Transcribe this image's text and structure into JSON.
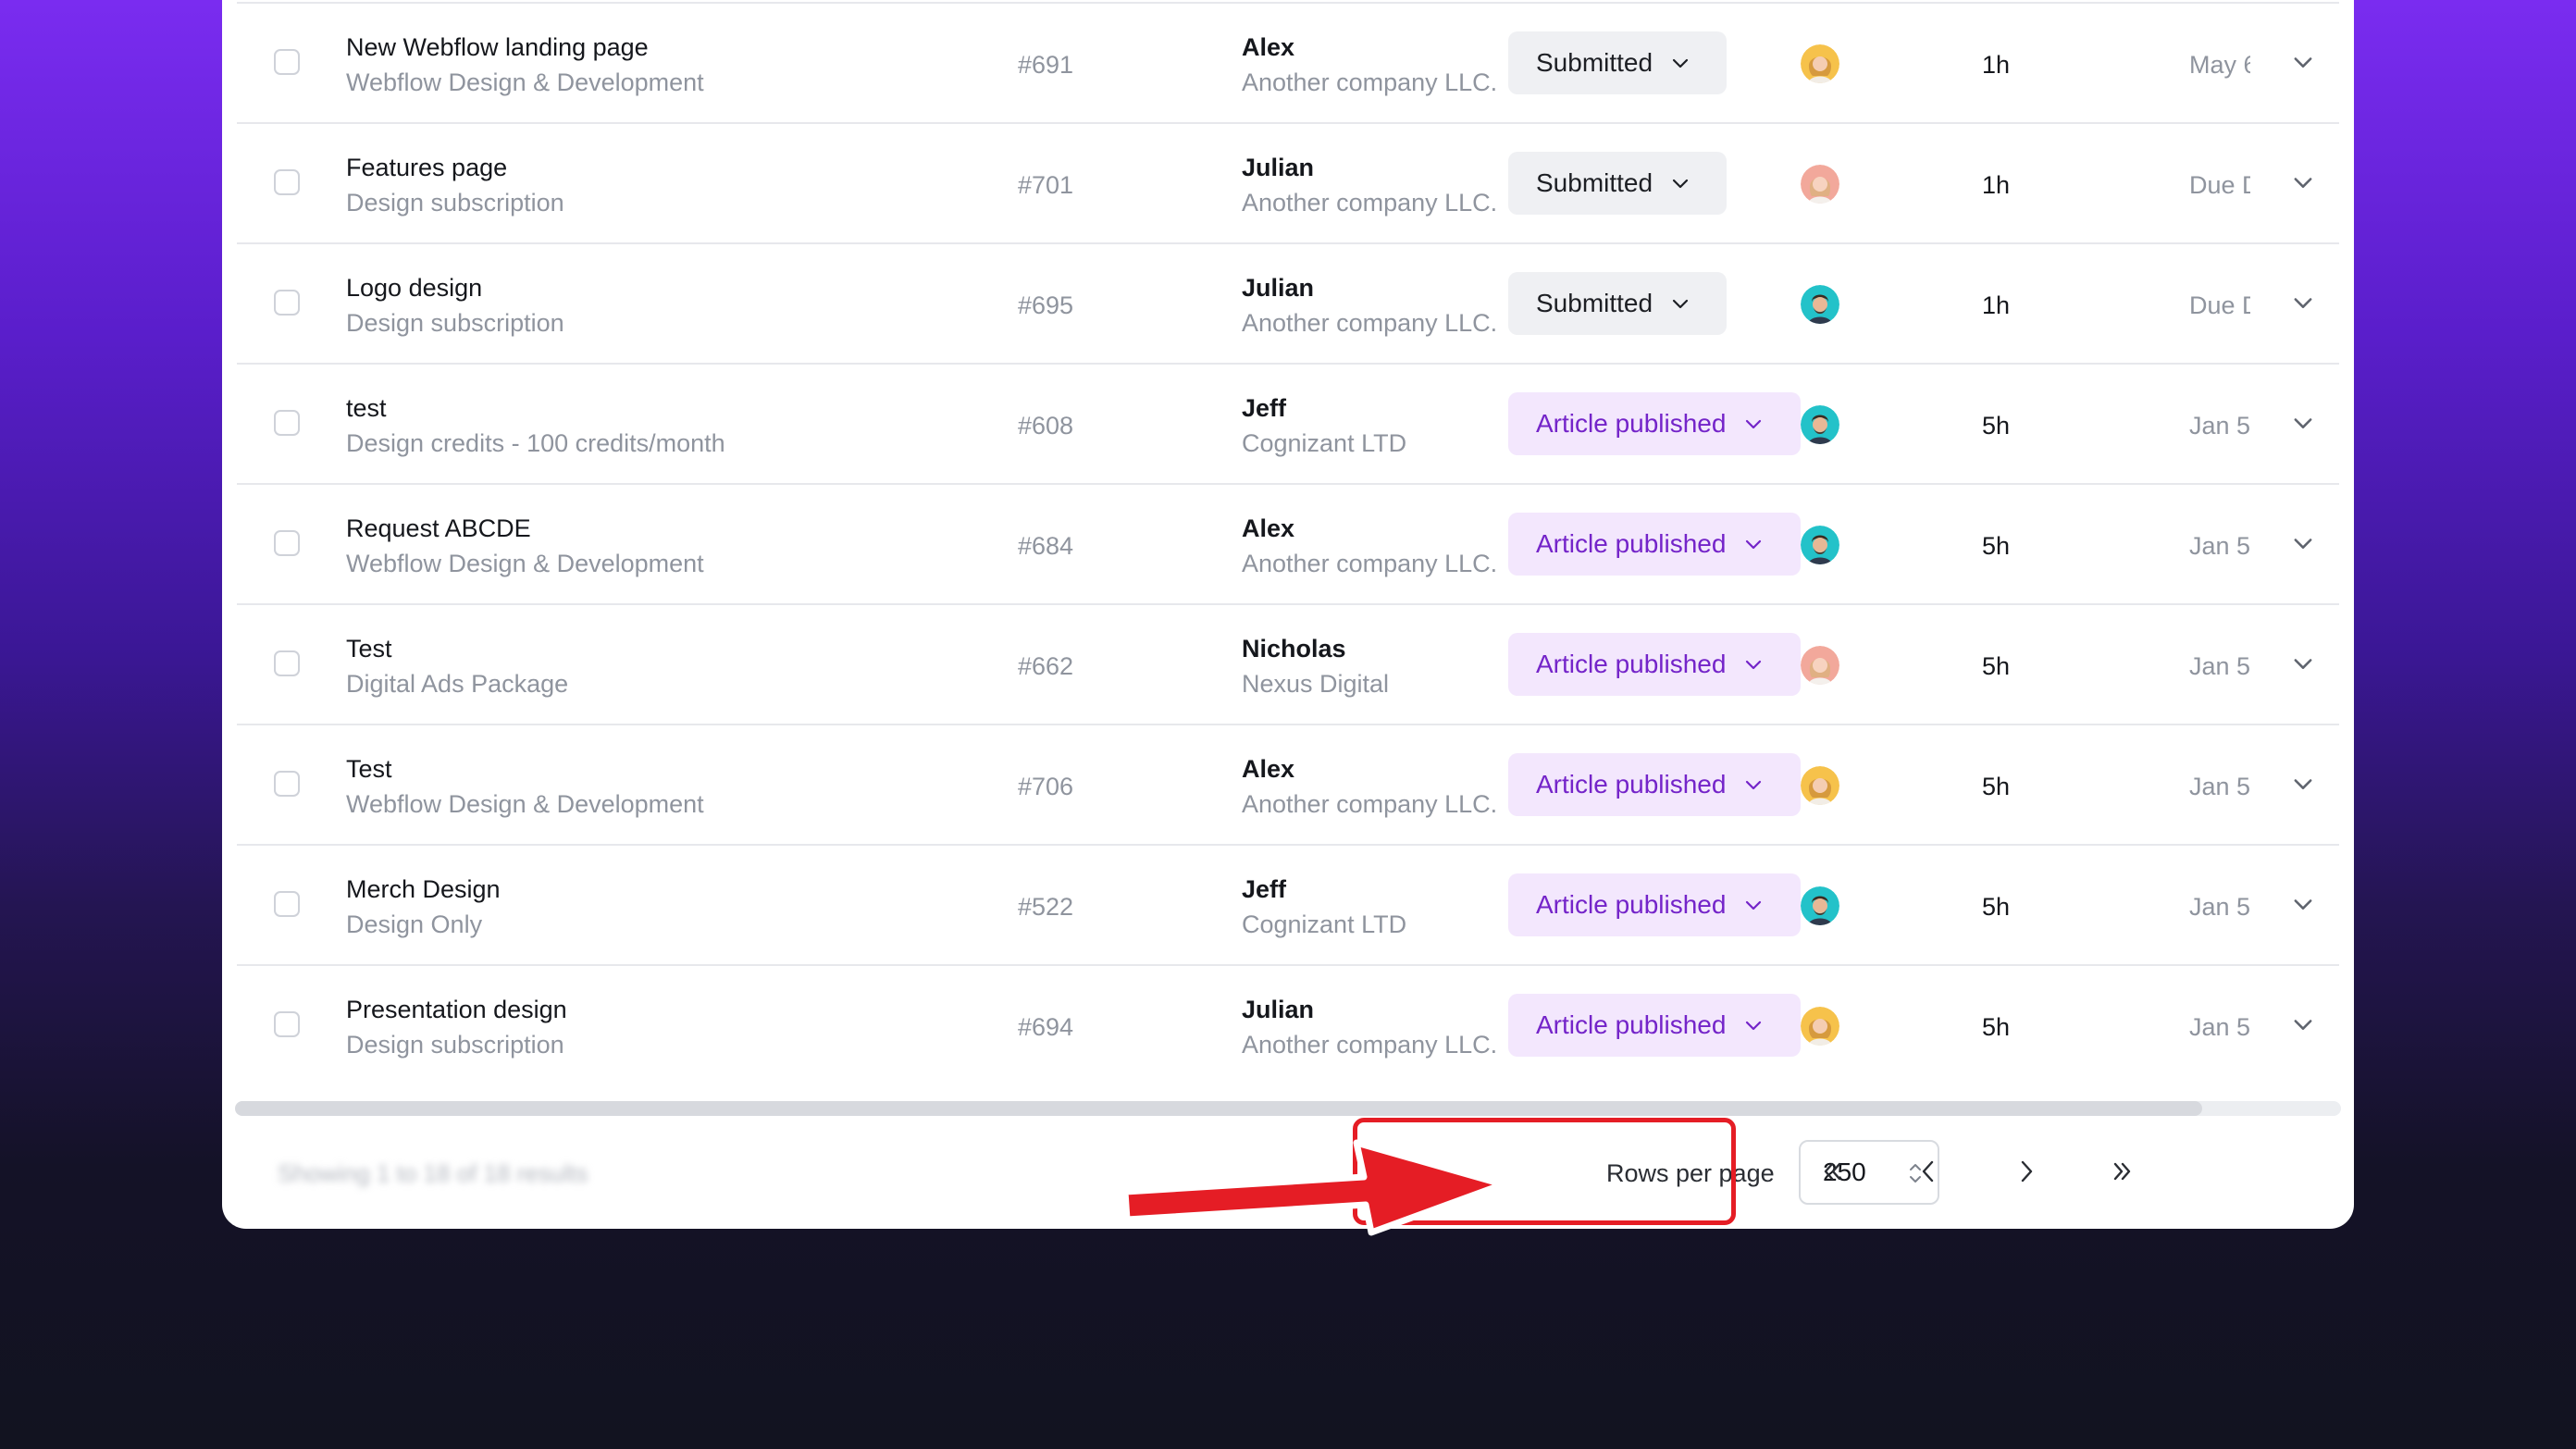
{
  "rows": [
    {
      "title": "New Webflow landing page",
      "subtitle": "Webflow Design & Development",
      "number": "#691",
      "client_name": "Alex",
      "client_company": "Another company LLC.",
      "status": "Submitted",
      "status_kind": "submitted",
      "avatar_icon": "avatar-woman-blonde",
      "time": "1h",
      "date": "May 6"
    },
    {
      "title": "Features page",
      "subtitle": "Design subscription",
      "number": "#701",
      "client_name": "Julian",
      "client_company": "Another company LLC.",
      "status": "Submitted",
      "status_kind": "submitted",
      "avatar_icon": "avatar-woman-pink",
      "time": "1h",
      "date": "Due Date"
    },
    {
      "title": "Logo design",
      "subtitle": "Design subscription",
      "number": "#695",
      "client_name": "Julian",
      "client_company": "Another company LLC.",
      "status": "Submitted",
      "status_kind": "submitted",
      "avatar_icon": "avatar-man-teal",
      "time": "1h",
      "date": "Due Date"
    },
    {
      "title": "test",
      "subtitle": "Design credits - 100 credits/month",
      "number": "#608",
      "client_name": "Jeff",
      "client_company": "Cognizant LTD",
      "status": "Article published",
      "status_kind": "published",
      "avatar_icon": "avatar-man-teal",
      "time": "5h",
      "date": "Jan 5"
    },
    {
      "title": "Request ABCDE",
      "subtitle": "Webflow Design & Development",
      "number": "#684",
      "client_name": "Alex",
      "client_company": "Another company LLC.",
      "status": "Article published",
      "status_kind": "published",
      "avatar_icon": "avatar-man-teal",
      "time": "5h",
      "date": "Jan 5"
    },
    {
      "title": "Test",
      "subtitle": "Digital Ads Package",
      "number": "#662",
      "client_name": "Nicholas",
      "client_company": "Nexus Digital",
      "status": "Article published",
      "status_kind": "published",
      "avatar_icon": "avatar-woman-pink",
      "time": "5h",
      "date": "Jan 5"
    },
    {
      "title": "Test",
      "subtitle": "Webflow Design & Development",
      "number": "#706",
      "client_name": "Alex",
      "client_company": "Another company LLC.",
      "status": "Article published",
      "status_kind": "published",
      "avatar_icon": "avatar-woman-blonde",
      "time": "5h",
      "date": "Jan 5"
    },
    {
      "title": "Merch Design",
      "subtitle": "Design Only",
      "number": "#522",
      "client_name": "Jeff",
      "client_company": "Cognizant LTD",
      "status": "Article published",
      "status_kind": "published",
      "avatar_icon": "avatar-man-teal",
      "time": "5h",
      "date": "Jan 5"
    },
    {
      "title": "Presentation design",
      "subtitle": "Design subscription",
      "number": "#694",
      "client_name": "Julian",
      "client_company": "Another company LLC.",
      "status": "Article published",
      "status_kind": "published",
      "avatar_icon": "avatar-woman-blonde",
      "time": "5h",
      "date": "Jan 5"
    }
  ],
  "footer": {
    "showing_text": "Showing 1 to 18 of 18 results",
    "rows_per_page_label": "Rows per page",
    "rows_per_page_value": "250",
    "first_page_icon": "chevrons-left-icon",
    "prev_page_icon": "chevron-left-icon",
    "next_page_icon": "chevron-right-icon",
    "last_page_icon": "chevrons-right-icon"
  },
  "annotation": {
    "highlight_color": "#e51d25",
    "arrow_color": "#e51d25"
  },
  "colors": {
    "published_bg": "#f3e7fd",
    "published_text": "#7424c9",
    "submitted_bg": "#eff0f3"
  }
}
